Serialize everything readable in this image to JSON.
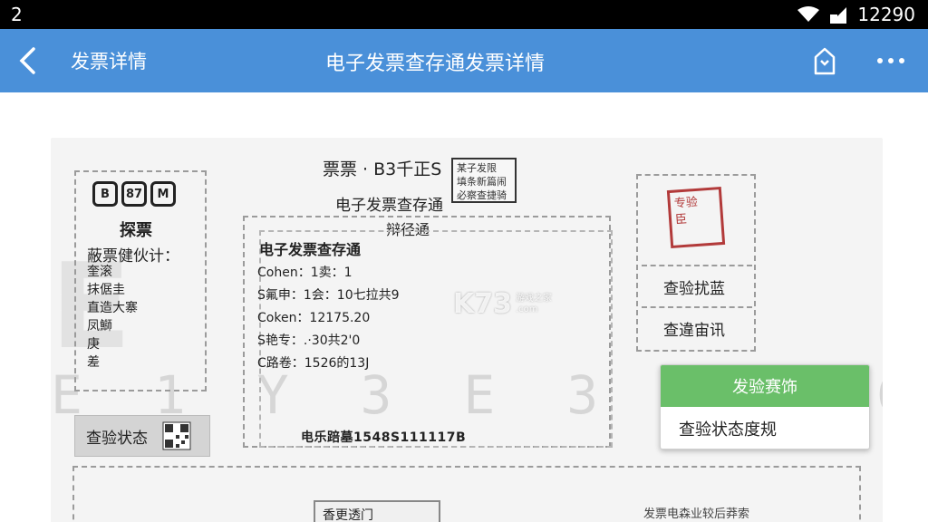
{
  "status_bar": {
    "left": "2",
    "time": "12290"
  },
  "app_bar": {
    "back_label": "发票详情",
    "title": "电子发票查存通发票详情"
  },
  "invoice": {
    "header_line": "票票 · B3千正S",
    "stamp_text": [
      "某子发限",
      "填条新篇闹",
      "必察查捷骑"
    ],
    "sub_title1": "电子发票查存通",
    "sub_title2": "辩径通",
    "left_panel": {
      "icons": [
        "B",
        "87",
        "M"
      ],
      "heading": "探票",
      "sub": "蔽票健伙计：",
      "list": [
        "奎滚",
        "抹倨圭",
        "直造大寨",
        "凤鰤",
        "庚",
        "差"
      ]
    },
    "center": {
      "title": "电子发票查存通",
      "rows": [
        "Cohen：1卖：1",
        "S氟申：1会：10七拉共9",
        "Coken：12175.20",
        "S艳专：.·30共2'0",
        "C路卷：1526的13J"
      ],
      "serial": "电乐踣墓1548S111117B"
    },
    "right_panel": {
      "stamp": [
        "专验",
        "臣"
      ],
      "btn1": "查验扰蓝",
      "btn2": "查違宙讯"
    },
    "faint_text": "E 1 Y 3 E 3 I C C H",
    "status_box": "查验状态",
    "bottom_tab": "香更透门",
    "bottom_note": "发票电森业较后莽索",
    "watermark": {
      "big": "K73",
      "small1": "游戏之家",
      "small2": ".com"
    }
  },
  "menu": {
    "item1": "发验赛饰",
    "item2": "查验状态度规"
  },
  "colors": {
    "app_bar": "#4a90d9",
    "menu_green": "#6abf69",
    "stamp_red": "#b23a3a"
  }
}
